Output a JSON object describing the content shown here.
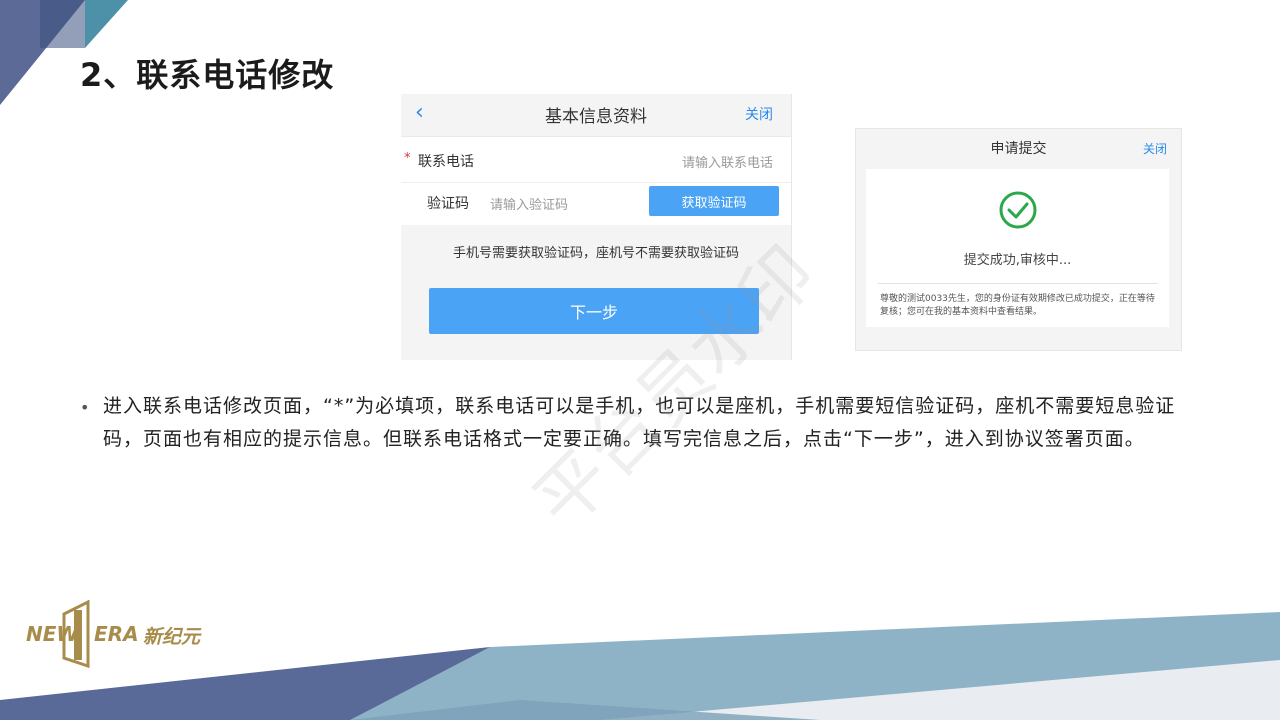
{
  "slide": {
    "title": "2、联系电话修改",
    "bullet": "进入联系电话修改页面，“*”为必填项，联系电话可以是手机，也可以是座机，手机需要短信验证码，座机不需要短息验证码，页面也有相应的提示信息。但联系电话格式一定要正确。填写完信息之后，点击“下一步”，进入到协议签署页面。",
    "watermark": "平台员水印"
  },
  "phone_form": {
    "back_icon": "chevron-left-icon",
    "title": "基本信息资料",
    "close_label": "关闭",
    "required_mark": "*",
    "phone_label": "联系电话",
    "phone_placeholder": "请输入联系电话",
    "code_label": "验证码",
    "code_placeholder": "请输入验证码",
    "get_code_label": "获取验证码",
    "hint": "手机号需要获取验证码，座机号不需要获取验证码",
    "next_label": "下一步"
  },
  "submit_result": {
    "title": "申请提交",
    "close_label": "关闭",
    "check_icon": "success-check-icon",
    "status": "提交成功,审核中...",
    "message": "尊敬的测试0033先生，您的身份证有效期修改已成功提交，正在等待复核；您可在我的基本资料中查看结果。"
  },
  "logo": {
    "left": "NEW",
    "right": "ERA",
    "cn": "新纪元"
  },
  "colors": {
    "accent_blue": "#4aa3f5",
    "link_blue": "#2a8bec",
    "success_green": "#2aa84a",
    "logo_gold": "#a88c4b",
    "deco_navy": "#3d4a7a",
    "deco_steel": "#7ea4bb"
  }
}
